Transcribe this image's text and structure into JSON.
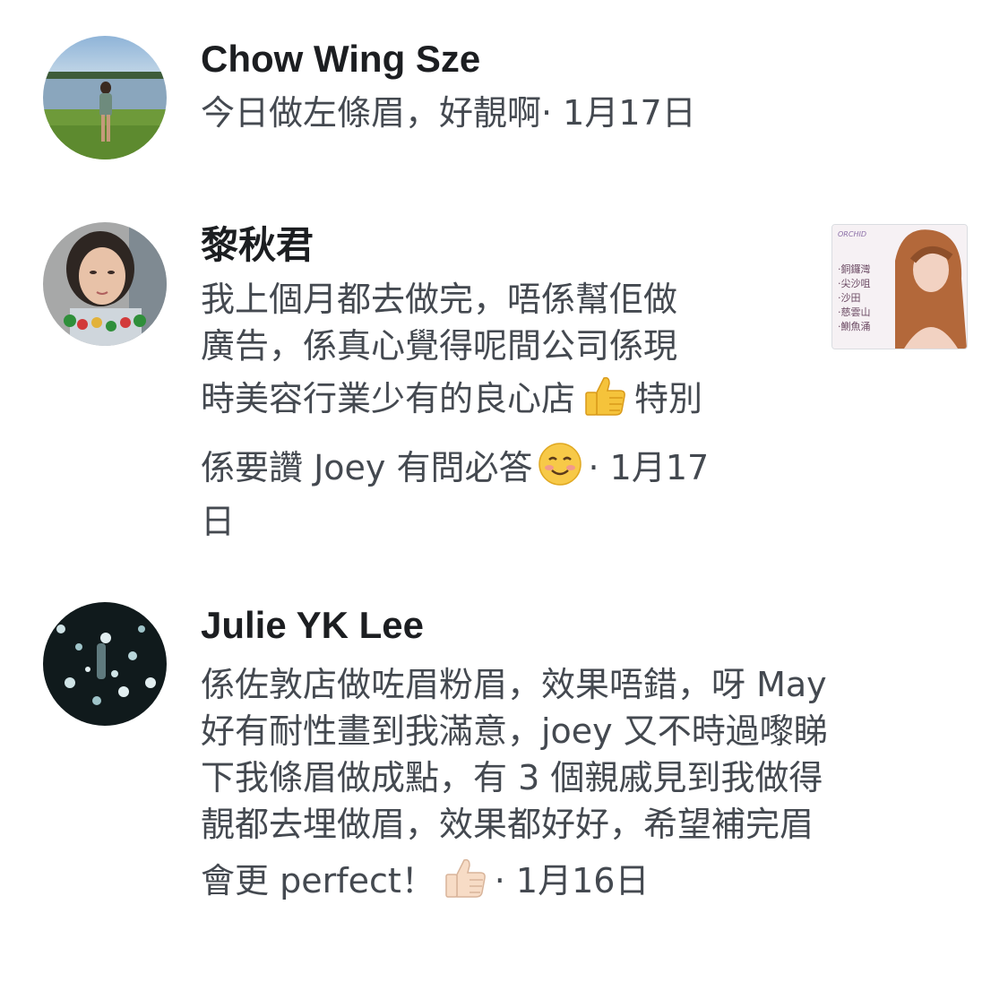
{
  "comments": [
    {
      "author": "Chow Wing Sze",
      "text_lines": [
        "今日做左條眉，好靚啊"
      ],
      "date": "· 1月17日"
    },
    {
      "author": "黎秋君",
      "text_lines": [
        "我上個月都去做完，唔係幫佢做",
        "廣告，係真心覺得呢間公司係現",
        "時美容行業少有的良心店",
        "特別",
        "係要讚 Joey 有問必答",
        "· 1月17",
        "日"
      ],
      "attachment": {
        "icon": "salon-advert-thumbnail",
        "branches": [
          "·銅鑼灣",
          "·尖沙咀",
          "·沙田",
          "·慈雲山",
          "·鰂魚涌"
        ]
      }
    },
    {
      "author": "Julie YK Lee",
      "text_lines": [
        "係佐敦店做咗眉粉眉，效果唔錯，呀 May",
        "好有耐性畫到我滿意，joey 又不時過嚟睇",
        "下我條眉做成點，有 3 個親戚見到我做得",
        "靚都去埋做眉，效果都好好，希望補完眉",
        "會更 perfect！"
      ],
      "date": "· 1月16日"
    }
  ],
  "icons": {
    "thumbs_up": "thumbs-up-emoji",
    "smile": "smiling-face-emoji",
    "thumbs_up_light": "thumbs-up-light-skin-emoji"
  },
  "colors": {
    "author": "#1c1e21",
    "text": "#444950",
    "background": "#ffffff"
  }
}
